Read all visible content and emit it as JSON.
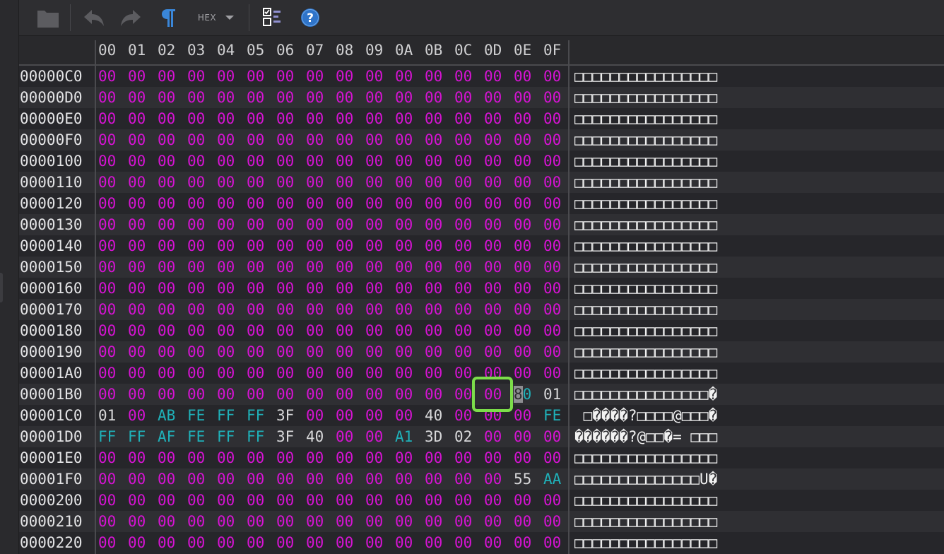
{
  "app": {
    "accent": "#3a86d8",
    "cursor_color": "#7cdd4a",
    "zero_byte_color": "#d613d3",
    "high_byte_color": "#1fb1b9"
  },
  "toolbar": {
    "buttons": [
      {
        "name": "folder-icon"
      },
      {
        "name": "undo-icon"
      },
      {
        "name": "redo-icon"
      },
      {
        "name": "pilcrow-icon"
      },
      {
        "name": "hex-dropdown",
        "label": "HEX"
      },
      {
        "name": "view-options-icon"
      },
      {
        "name": "help-icon"
      }
    ],
    "hex_label": "HEX"
  },
  "columns": [
    "00",
    "01",
    "02",
    "03",
    "04",
    "05",
    "06",
    "07",
    "08",
    "09",
    "0A",
    "0B",
    "0C",
    "0D",
    "0E",
    "0F"
  ],
  "rows": [
    {
      "addr": "00000C0",
      "bytes": [
        "00",
        "00",
        "00",
        "00",
        "00",
        "00",
        "00",
        "00",
        "00",
        "00",
        "00",
        "00",
        "00",
        "00",
        "00",
        "00"
      ],
      "ascii": "□□□□□□□□□□□□□□□□"
    },
    {
      "addr": "00000D0",
      "bytes": [
        "00",
        "00",
        "00",
        "00",
        "00",
        "00",
        "00",
        "00",
        "00",
        "00",
        "00",
        "00",
        "00",
        "00",
        "00",
        "00"
      ],
      "ascii": "□□□□□□□□□□□□□□□□"
    },
    {
      "addr": "00000E0",
      "bytes": [
        "00",
        "00",
        "00",
        "00",
        "00",
        "00",
        "00",
        "00",
        "00",
        "00",
        "00",
        "00",
        "00",
        "00",
        "00",
        "00"
      ],
      "ascii": "□□□□□□□□□□□□□□□□"
    },
    {
      "addr": "00000F0",
      "bytes": [
        "00",
        "00",
        "00",
        "00",
        "00",
        "00",
        "00",
        "00",
        "00",
        "00",
        "00",
        "00",
        "00",
        "00",
        "00",
        "00"
      ],
      "ascii": "□□□□□□□□□□□□□□□□"
    },
    {
      "addr": "0000100",
      "bytes": [
        "00",
        "00",
        "00",
        "00",
        "00",
        "00",
        "00",
        "00",
        "00",
        "00",
        "00",
        "00",
        "00",
        "00",
        "00",
        "00"
      ],
      "ascii": "□□□□□□□□□□□□□□□□"
    },
    {
      "addr": "0000110",
      "bytes": [
        "00",
        "00",
        "00",
        "00",
        "00",
        "00",
        "00",
        "00",
        "00",
        "00",
        "00",
        "00",
        "00",
        "00",
        "00",
        "00"
      ],
      "ascii": "□□□□□□□□□□□□□□□□"
    },
    {
      "addr": "0000120",
      "bytes": [
        "00",
        "00",
        "00",
        "00",
        "00",
        "00",
        "00",
        "00",
        "00",
        "00",
        "00",
        "00",
        "00",
        "00",
        "00",
        "00"
      ],
      "ascii": "□□□□□□□□□□□□□□□□"
    },
    {
      "addr": "0000130",
      "bytes": [
        "00",
        "00",
        "00",
        "00",
        "00",
        "00",
        "00",
        "00",
        "00",
        "00",
        "00",
        "00",
        "00",
        "00",
        "00",
        "00"
      ],
      "ascii": "□□□□□□□□□□□□□□□□"
    },
    {
      "addr": "0000140",
      "bytes": [
        "00",
        "00",
        "00",
        "00",
        "00",
        "00",
        "00",
        "00",
        "00",
        "00",
        "00",
        "00",
        "00",
        "00",
        "00",
        "00"
      ],
      "ascii": "□□□□□□□□□□□□□□□□"
    },
    {
      "addr": "0000150",
      "bytes": [
        "00",
        "00",
        "00",
        "00",
        "00",
        "00",
        "00",
        "00",
        "00",
        "00",
        "00",
        "00",
        "00",
        "00",
        "00",
        "00"
      ],
      "ascii": "□□□□□□□□□□□□□□□□"
    },
    {
      "addr": "0000160",
      "bytes": [
        "00",
        "00",
        "00",
        "00",
        "00",
        "00",
        "00",
        "00",
        "00",
        "00",
        "00",
        "00",
        "00",
        "00",
        "00",
        "00"
      ],
      "ascii": "□□□□□□□□□□□□□□□□"
    },
    {
      "addr": "0000170",
      "bytes": [
        "00",
        "00",
        "00",
        "00",
        "00",
        "00",
        "00",
        "00",
        "00",
        "00",
        "00",
        "00",
        "00",
        "00",
        "00",
        "00"
      ],
      "ascii": "□□□□□□□□□□□□□□□□"
    },
    {
      "addr": "0000180",
      "bytes": [
        "00",
        "00",
        "00",
        "00",
        "00",
        "00",
        "00",
        "00",
        "00",
        "00",
        "00",
        "00",
        "00",
        "00",
        "00",
        "00"
      ],
      "ascii": "□□□□□□□□□□□□□□□□"
    },
    {
      "addr": "0000190",
      "bytes": [
        "00",
        "00",
        "00",
        "00",
        "00",
        "00",
        "00",
        "00",
        "00",
        "00",
        "00",
        "00",
        "00",
        "00",
        "00",
        "00"
      ],
      "ascii": "□□□□□□□□□□□□□□□□"
    },
    {
      "addr": "00001A0",
      "bytes": [
        "00",
        "00",
        "00",
        "00",
        "00",
        "00",
        "00",
        "00",
        "00",
        "00",
        "00",
        "00",
        "00",
        "00",
        "00",
        "00"
      ],
      "ascii": "□□□□□□□□□□□□□□□□"
    },
    {
      "addr": "00001B0",
      "bytes": [
        "00",
        "00",
        "00",
        "00",
        "00",
        "00",
        "00",
        "00",
        "00",
        "00",
        "00",
        "00",
        "00",
        "00",
        "80",
        "01"
      ],
      "ascii": "□□□□□□□□□□□□□□□�"
    },
    {
      "addr": "00001C0",
      "bytes": [
        "01",
        "00",
        "AB",
        "FE",
        "FF",
        "FF",
        "3F",
        "00",
        "00",
        "00",
        "00",
        "40",
        "00",
        "00",
        "00",
        "FE"
      ],
      "ascii": " □����?□□□□@□□□�"
    },
    {
      "addr": "00001D0",
      "bytes": [
        "FF",
        "FF",
        "AF",
        "FE",
        "FF",
        "FF",
        "3F",
        "40",
        "00",
        "00",
        "A1",
        "3D",
        "02",
        "00",
        "00",
        "00"
      ],
      "ascii": "������?@□□�= □□□"
    },
    {
      "addr": "00001E0",
      "bytes": [
        "00",
        "00",
        "00",
        "00",
        "00",
        "00",
        "00",
        "00",
        "00",
        "00",
        "00",
        "00",
        "00",
        "00",
        "00",
        "00"
      ],
      "ascii": "□□□□□□□□□□□□□□□□"
    },
    {
      "addr": "00001F0",
      "bytes": [
        "00",
        "00",
        "00",
        "00",
        "00",
        "00",
        "00",
        "00",
        "00",
        "00",
        "00",
        "00",
        "00",
        "00",
        "55",
        "AA"
      ],
      "ascii": "□□□□□□□□□□□□□□U�"
    },
    {
      "addr": "0000200",
      "bytes": [
        "00",
        "00",
        "00",
        "00",
        "00",
        "00",
        "00",
        "00",
        "00",
        "00",
        "00",
        "00",
        "00",
        "00",
        "00",
        "00"
      ],
      "ascii": "□□□□□□□□□□□□□□□□"
    },
    {
      "addr": "0000210",
      "bytes": [
        "00",
        "00",
        "00",
        "00",
        "00",
        "00",
        "00",
        "00",
        "00",
        "00",
        "00",
        "00",
        "00",
        "00",
        "00",
        "00"
      ],
      "ascii": "□□□□□□□□□□□□□□□□"
    },
    {
      "addr": "0000220",
      "bytes": [
        "00",
        "00",
        "00",
        "00",
        "00",
        "00",
        "00",
        "00",
        "00",
        "00",
        "00",
        "00",
        "00",
        "00",
        "00",
        "00"
      ],
      "ascii": "□□□□□□□□□□□□□□□□"
    }
  ],
  "selection": {
    "addr": "00001B0",
    "column": "0D"
  },
  "caret": {
    "addr": "00001B0",
    "column": "0E",
    "nibble": 0
  }
}
